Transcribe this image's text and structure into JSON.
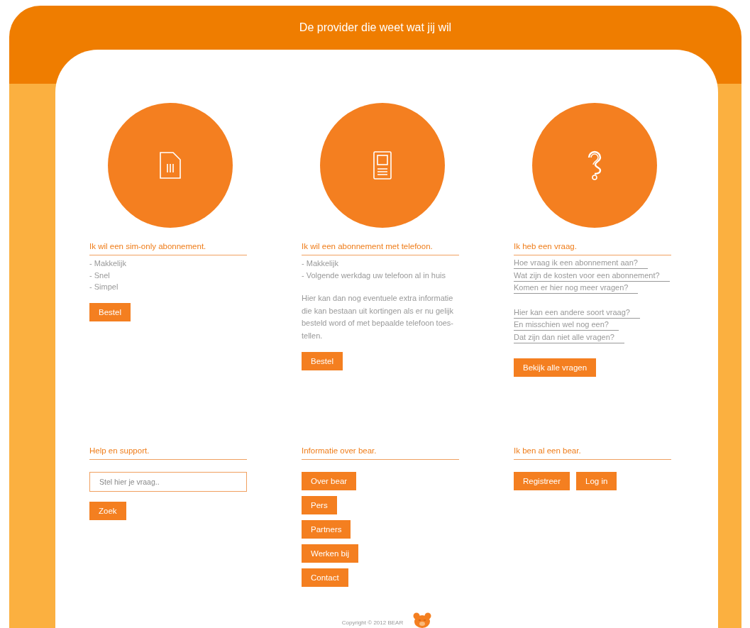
{
  "header": {
    "tagline": "De provider die weet wat jij wil"
  },
  "offers": [
    {
      "kind": "sim",
      "title": "Ik wil een sim-only abonnement.",
      "items": [
        "- Makkelijk",
        "- Snel",
        "- Simpel"
      ],
      "button": "Bestel"
    },
    {
      "kind": "phone",
      "title": "Ik wil een abonnement met telefoon.",
      "items": [
        "- Makkelijk",
        "- Volgende werkdag uw telefoon al in huis"
      ],
      "paragraph": "Hier kan dan nog eventuele extra informatie die kan bestaan uit kortingen als er nu gelijk besteld word of met bepaalde telefoon toes-tellen.",
      "button": "Bestel"
    },
    {
      "kind": "question",
      "title": "Ik heb een vraag.",
      "link_groups": [
        [
          "Hoe vraag ik een abonnement aan?",
          "Wat zijn de kosten voor een abonnement?",
          "Komen er hier nog meer vragen?"
        ],
        [
          "Hier kan een andere soort vraag?",
          "En misschien wel nog een?",
          "Dat zijn dan niet alle vragen?"
        ]
      ],
      "button": "Bekijk alle vragen"
    }
  ],
  "support": {
    "title": "Help en support.",
    "search": {
      "placeholder": "Stel hier je vraag.."
    },
    "button": "Zoek"
  },
  "info": {
    "title": "Informatie over bear.",
    "buttons": [
      "Over bear",
      "Pers",
      "Partners",
      "Werken bij",
      "Contact"
    ]
  },
  "account": {
    "title": "Ik ben al een bear.",
    "buttons": [
      "Registreer",
      "Log in"
    ]
  },
  "footer": {
    "copyright": "Copyright © 2012 BEAR"
  }
}
